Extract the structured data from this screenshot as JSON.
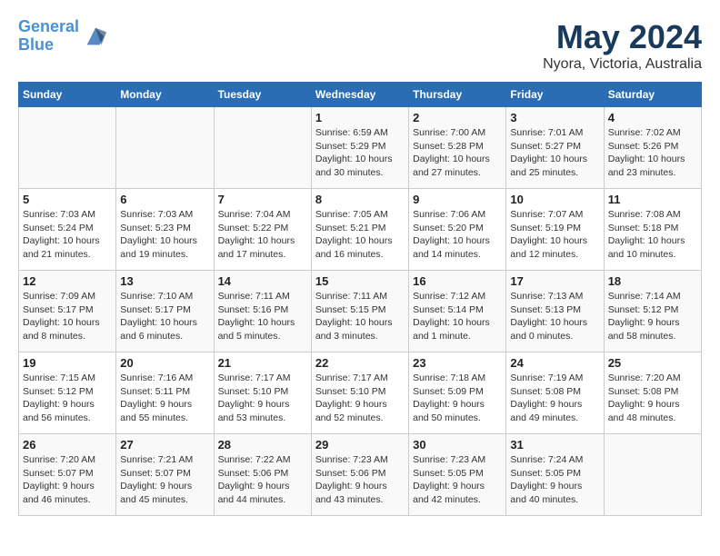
{
  "header": {
    "logo_line1": "General",
    "logo_line2": "Blue",
    "month": "May 2024",
    "location": "Nyora, Victoria, Australia"
  },
  "weekdays": [
    "Sunday",
    "Monday",
    "Tuesday",
    "Wednesday",
    "Thursday",
    "Friday",
    "Saturday"
  ],
  "weeks": [
    [
      {
        "day": "",
        "info": ""
      },
      {
        "day": "",
        "info": ""
      },
      {
        "day": "",
        "info": ""
      },
      {
        "day": "1",
        "info": "Sunrise: 6:59 AM\nSunset: 5:29 PM\nDaylight: 10 hours\nand 30 minutes."
      },
      {
        "day": "2",
        "info": "Sunrise: 7:00 AM\nSunset: 5:28 PM\nDaylight: 10 hours\nand 27 minutes."
      },
      {
        "day": "3",
        "info": "Sunrise: 7:01 AM\nSunset: 5:27 PM\nDaylight: 10 hours\nand 25 minutes."
      },
      {
        "day": "4",
        "info": "Sunrise: 7:02 AM\nSunset: 5:26 PM\nDaylight: 10 hours\nand 23 minutes."
      }
    ],
    [
      {
        "day": "5",
        "info": "Sunrise: 7:03 AM\nSunset: 5:24 PM\nDaylight: 10 hours\nand 21 minutes."
      },
      {
        "day": "6",
        "info": "Sunrise: 7:03 AM\nSunset: 5:23 PM\nDaylight: 10 hours\nand 19 minutes."
      },
      {
        "day": "7",
        "info": "Sunrise: 7:04 AM\nSunset: 5:22 PM\nDaylight: 10 hours\nand 17 minutes."
      },
      {
        "day": "8",
        "info": "Sunrise: 7:05 AM\nSunset: 5:21 PM\nDaylight: 10 hours\nand 16 minutes."
      },
      {
        "day": "9",
        "info": "Sunrise: 7:06 AM\nSunset: 5:20 PM\nDaylight: 10 hours\nand 14 minutes."
      },
      {
        "day": "10",
        "info": "Sunrise: 7:07 AM\nSunset: 5:19 PM\nDaylight: 10 hours\nand 12 minutes."
      },
      {
        "day": "11",
        "info": "Sunrise: 7:08 AM\nSunset: 5:18 PM\nDaylight: 10 hours\nand 10 minutes."
      }
    ],
    [
      {
        "day": "12",
        "info": "Sunrise: 7:09 AM\nSunset: 5:17 PM\nDaylight: 10 hours\nand 8 minutes."
      },
      {
        "day": "13",
        "info": "Sunrise: 7:10 AM\nSunset: 5:17 PM\nDaylight: 10 hours\nand 6 minutes."
      },
      {
        "day": "14",
        "info": "Sunrise: 7:11 AM\nSunset: 5:16 PM\nDaylight: 10 hours\nand 5 minutes."
      },
      {
        "day": "15",
        "info": "Sunrise: 7:11 AM\nSunset: 5:15 PM\nDaylight: 10 hours\nand 3 minutes."
      },
      {
        "day": "16",
        "info": "Sunrise: 7:12 AM\nSunset: 5:14 PM\nDaylight: 10 hours\nand 1 minute."
      },
      {
        "day": "17",
        "info": "Sunrise: 7:13 AM\nSunset: 5:13 PM\nDaylight: 10 hours\nand 0 minutes."
      },
      {
        "day": "18",
        "info": "Sunrise: 7:14 AM\nSunset: 5:12 PM\nDaylight: 9 hours\nand 58 minutes."
      }
    ],
    [
      {
        "day": "19",
        "info": "Sunrise: 7:15 AM\nSunset: 5:12 PM\nDaylight: 9 hours\nand 56 minutes."
      },
      {
        "day": "20",
        "info": "Sunrise: 7:16 AM\nSunset: 5:11 PM\nDaylight: 9 hours\nand 55 minutes."
      },
      {
        "day": "21",
        "info": "Sunrise: 7:17 AM\nSunset: 5:10 PM\nDaylight: 9 hours\nand 53 minutes."
      },
      {
        "day": "22",
        "info": "Sunrise: 7:17 AM\nSunset: 5:10 PM\nDaylight: 9 hours\nand 52 minutes."
      },
      {
        "day": "23",
        "info": "Sunrise: 7:18 AM\nSunset: 5:09 PM\nDaylight: 9 hours\nand 50 minutes."
      },
      {
        "day": "24",
        "info": "Sunrise: 7:19 AM\nSunset: 5:08 PM\nDaylight: 9 hours\nand 49 minutes."
      },
      {
        "day": "25",
        "info": "Sunrise: 7:20 AM\nSunset: 5:08 PM\nDaylight: 9 hours\nand 48 minutes."
      }
    ],
    [
      {
        "day": "26",
        "info": "Sunrise: 7:20 AM\nSunset: 5:07 PM\nDaylight: 9 hours\nand 46 minutes."
      },
      {
        "day": "27",
        "info": "Sunrise: 7:21 AM\nSunset: 5:07 PM\nDaylight: 9 hours\nand 45 minutes."
      },
      {
        "day": "28",
        "info": "Sunrise: 7:22 AM\nSunset: 5:06 PM\nDaylight: 9 hours\nand 44 minutes."
      },
      {
        "day": "29",
        "info": "Sunrise: 7:23 AM\nSunset: 5:06 PM\nDaylight: 9 hours\nand 43 minutes."
      },
      {
        "day": "30",
        "info": "Sunrise: 7:23 AM\nSunset: 5:05 PM\nDaylight: 9 hours\nand 42 minutes."
      },
      {
        "day": "31",
        "info": "Sunrise: 7:24 AM\nSunset: 5:05 PM\nDaylight: 9 hours\nand 40 minutes."
      },
      {
        "day": "",
        "info": ""
      }
    ]
  ]
}
